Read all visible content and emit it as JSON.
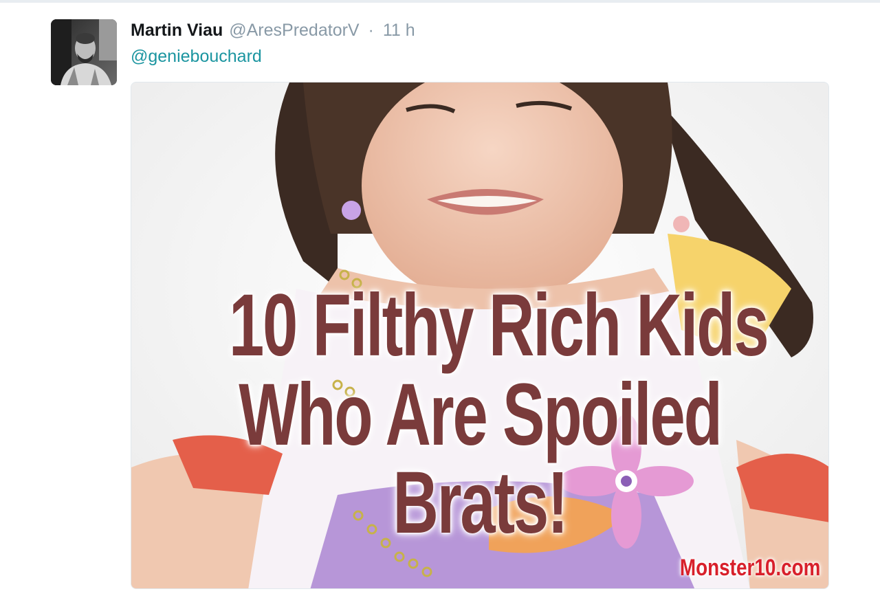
{
  "tweet": {
    "fullname": "Martin Viau",
    "username": "@AresPredatorV",
    "separator": "·",
    "time": "11 h",
    "text": "@geniebouchard"
  },
  "media": {
    "headline_line1": "10 Filthy Rich Kids",
    "headline_line2": "Who Are Spoiled",
    "headline_line3": "Brats!",
    "watermark": "Monster10.com"
  },
  "colors": {
    "link": "#1b95a0",
    "name": "#14171a",
    "meta": "#8899a6",
    "headline": "#7a3b3b",
    "watermark": "#d8202b"
  }
}
